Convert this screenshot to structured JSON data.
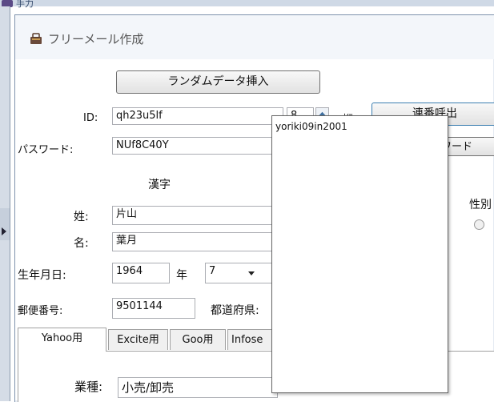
{
  "outer_window": {
    "title": "手力"
  },
  "dialog": {
    "title": "フリーメール作成",
    "random_button": "ランダムデータ挿入",
    "id": {
      "label": "ID:",
      "value": "qh23u5lf",
      "digits_value": "8",
      "digits_unit": "桁"
    },
    "serial_button": "連番呼出",
    "password": {
      "label": "パスワード:",
      "value": "NUf8C40Y",
      "button": "ワード"
    },
    "kanji_header": "漢字",
    "last_name": {
      "label": "姓:",
      "value": "片山"
    },
    "first_name": {
      "label": "名:",
      "value": "葉月"
    },
    "gender_label": "性別",
    "birth": {
      "label": "生年月日:",
      "year": "1964",
      "year_unit": "年",
      "month": "7"
    },
    "postal": {
      "label": "郵便番号:",
      "value": "9501144"
    },
    "prefecture_label": "都道府県:",
    "tabs": [
      {
        "label": "Yahoo用",
        "selected": true
      },
      {
        "label": "Excite用",
        "selected": false
      },
      {
        "label": "Goo用",
        "selected": false
      },
      {
        "label": "Infose",
        "selected": false
      }
    ],
    "industry": {
      "label": "業種:",
      "value": "小売/卸売"
    }
  },
  "dropdown": {
    "items": [
      "yoriki09in2001"
    ]
  },
  "icons": {
    "app_icon": "bag-icon",
    "spinner": "spin-arrow-icon",
    "month_arrow": "chevron-down-icon"
  }
}
